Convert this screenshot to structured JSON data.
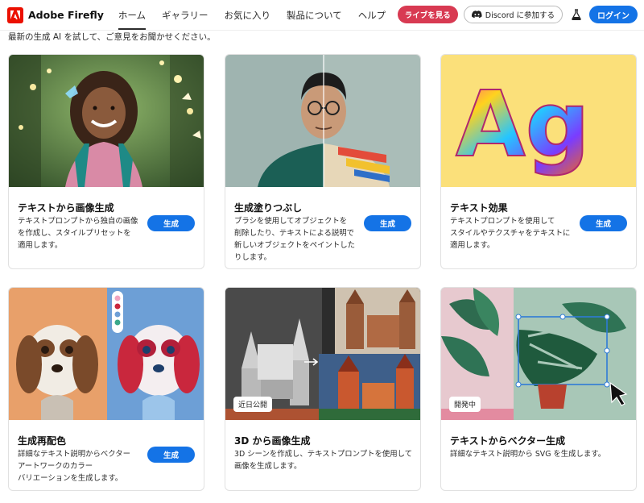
{
  "header": {
    "brand": "Adobe Firefly",
    "nav": [
      "ホーム",
      "ギャラリー",
      "お気に入り",
      "製品について",
      "ヘルプ"
    ],
    "live_label": "ライブを見る",
    "discord_label": "Discord に参加する",
    "login_label": "ログイン"
  },
  "intro_text": "最新の生成 AI を試して、ご意見をお聞かせください。",
  "cards": [
    {
      "title": "テキストから画像生成",
      "desc": [
        "テキストプロンプトから独自の画像",
        "を作成し、スタイルプリセットを",
        "適用します。"
      ],
      "button": "生成"
    },
    {
      "title": "生成塗りつぶし",
      "desc": [
        "ブラシを使用してオブジェクトを",
        "削除したり、テキストによる説明で",
        "新しいオブジェクトをペイントした",
        "りします。"
      ],
      "button": "生成"
    },
    {
      "title": "テキスト効果",
      "desc": [
        "テキストプロンプトを使用して",
        "スタイルやテクスチャをテキストに",
        "適用します。"
      ],
      "button": "生成",
      "art_text": "Ag"
    },
    {
      "title": "生成再配色",
      "desc": [
        "詳細なテキスト説明からベクター",
        "アートワークのカラー",
        "バリエーションを生成します。"
      ],
      "button": "生成"
    },
    {
      "title": "3D から画像生成",
      "desc": [
        "3D シーンを作成し、テキストプロンプトを使用して",
        "画像を生成します。"
      ],
      "tag": "近日公開"
    },
    {
      "title": "テキストからベクター生成",
      "desc": [
        "詳細なテキスト説明から SVG を生成します。"
      ],
      "tag": "開発中"
    }
  ]
}
